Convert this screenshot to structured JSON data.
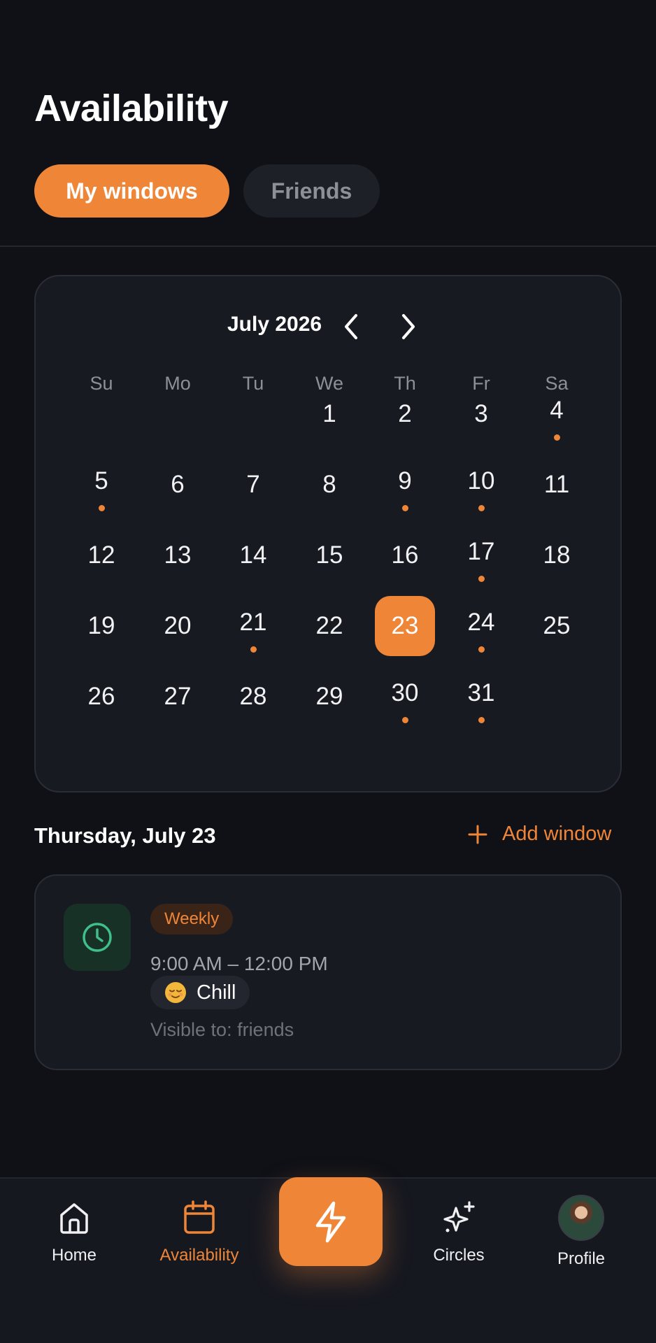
{
  "header": {
    "title": "Availability"
  },
  "tabs": [
    {
      "label": "My windows",
      "active": true
    },
    {
      "label": "Friends",
      "active": false
    }
  ],
  "calendar": {
    "month_label": "July 2026",
    "weekdays": [
      "Su",
      "Mo",
      "Tu",
      "We",
      "Th",
      "Fr",
      "Sa"
    ],
    "selected_day": "23",
    "days_with_windows": [
      "4",
      "5",
      "9",
      "10",
      "17",
      "21",
      "24",
      "30",
      "31"
    ],
    "weeks": [
      [
        "",
        "",
        "",
        "1",
        "2",
        "3",
        "4"
      ],
      [
        "5",
        "6",
        "7",
        "8",
        "9",
        "10",
        "11"
      ],
      [
        "12",
        "13",
        "14",
        "15",
        "16",
        "17",
        "18"
      ],
      [
        "19",
        "20",
        "21",
        "22",
        "23",
        "24",
        "25"
      ],
      [
        "26",
        "27",
        "28",
        "29",
        "30",
        "31",
        ""
      ]
    ]
  },
  "day_detail": {
    "date_label": "Thursday, July 23",
    "add_label": "Add window"
  },
  "window": {
    "icon": "clock-icon",
    "recurrence": "Weekly",
    "time_range": "9:00 AM – 12:00 PM",
    "mood_label": "Chill",
    "mood_icon": "relieved-face-emoji",
    "visibility": "Visible to: friends"
  },
  "nav": {
    "items": [
      {
        "label": "Home",
        "icon": "home-icon"
      },
      {
        "label": "Availability",
        "icon": "calendar-icon",
        "active": true
      },
      {
        "label": "Circles",
        "icon": "sparkles-icon"
      },
      {
        "label": "Profile",
        "icon": "avatar"
      }
    ],
    "center_action_icon": "lightning-icon"
  },
  "colors": {
    "accent": "#ef8537",
    "background": "#0f1117",
    "card": "#181a21",
    "window_icon_bg": "#183127",
    "window_icon": "#3fbf8a"
  }
}
